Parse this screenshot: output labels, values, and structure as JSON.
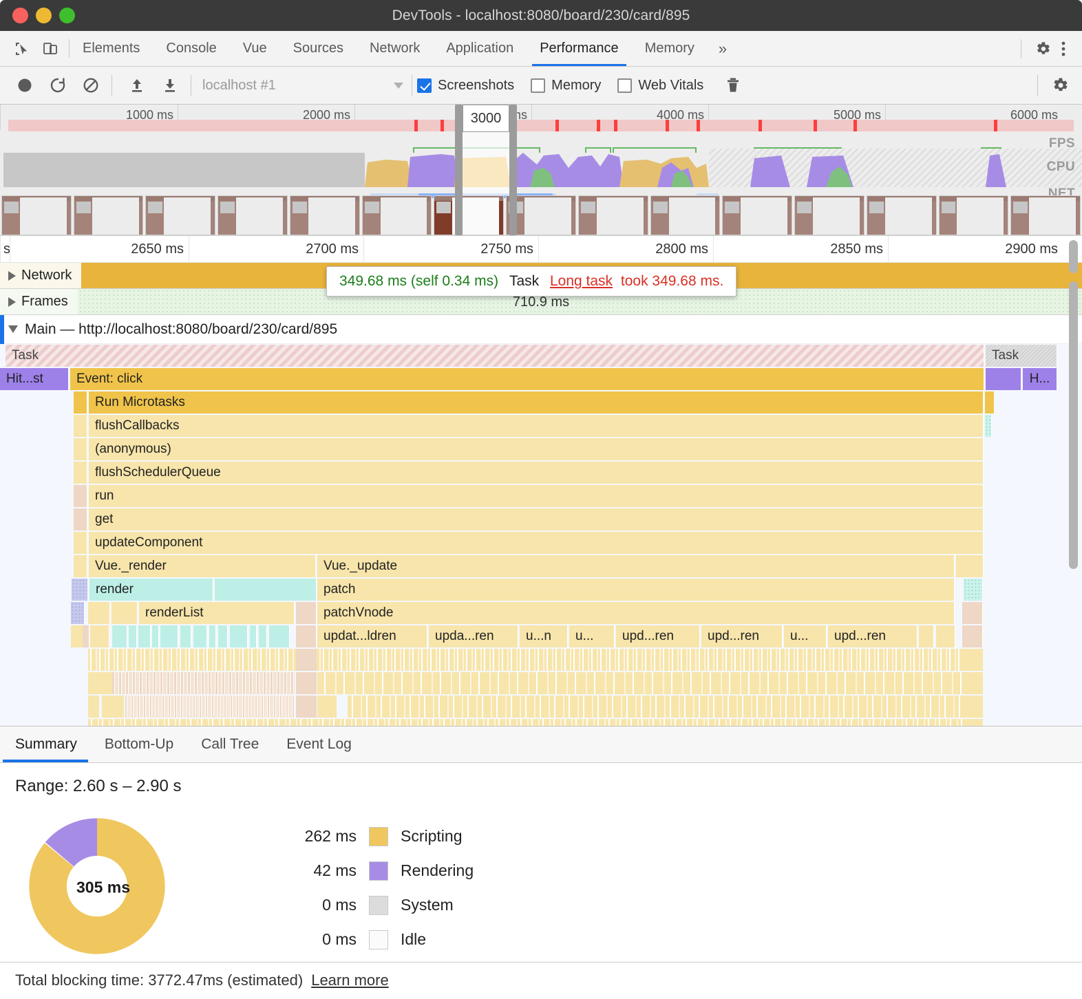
{
  "window": {
    "title": "DevTools - localhost:8080/board/230/card/895",
    "traffic": [
      "close-button",
      "minimize-button",
      "maximize-button"
    ]
  },
  "tabbar": {
    "left_icons": [
      "inspect-element-icon",
      "device-toolbar-icon"
    ],
    "tabs": [
      {
        "label": "Elements",
        "active": false
      },
      {
        "label": "Console",
        "active": false
      },
      {
        "label": "Vue",
        "active": false
      },
      {
        "label": "Sources",
        "active": false
      },
      {
        "label": "Network",
        "active": false
      },
      {
        "label": "Application",
        "active": false
      },
      {
        "label": "Performance",
        "active": true
      },
      {
        "label": "Memory",
        "active": false
      }
    ],
    "more_label": "»",
    "right_icons": [
      "settings-gear-icon",
      "more-vertical-icon"
    ]
  },
  "controlbar": {
    "record_icon": "record-circle-icon",
    "reload_icon": "reload-record-icon",
    "clear_icon": "clear-icon",
    "upload_icon": "load-profile-icon",
    "download_icon": "save-profile-icon",
    "session_value": "localhost #1",
    "checkboxes": [
      {
        "label": "Screenshots",
        "checked": true
      },
      {
        "label": "Memory",
        "checked": false
      },
      {
        "label": "Web Vitals",
        "checked": false
      }
    ],
    "trash_icon": "delete-icon",
    "settings_icon": "capture-settings-gear-icon"
  },
  "overview": {
    "ruler_ticks": [
      "1000 ms",
      "2000 ms",
      "3000 ms",
      "4000 ms",
      "5000 ms",
      "6000 ms"
    ],
    "lanes": [
      "FPS",
      "CPU",
      "NET"
    ],
    "selection_label": "3000",
    "selection_suffix": "ms"
  },
  "flamechart": {
    "ruler_ticks": [
      "s",
      "2650 ms",
      "2700 ms",
      "2750 ms",
      "2800 ms",
      "2850 ms",
      "2900 ms"
    ],
    "network_track": "Network",
    "frames_track": "Frames",
    "frames_duration": "710.9 ms",
    "main_track": "Main — http://localhost:8080/board/230/card/895",
    "task_label": "Task",
    "task_label_right": "Task",
    "rows": [
      {
        "name": "hit-test",
        "label": "Hit...st"
      },
      {
        "name": "event-click",
        "label": "Event: click"
      },
      {
        "name": "run-microtasks",
        "label": "Run Microtasks"
      },
      {
        "name": "flush-callbacks",
        "label": "flushCallbacks"
      },
      {
        "name": "anonymous",
        "label": "(anonymous)"
      },
      {
        "name": "flush-scheduler-queue",
        "label": "flushSchedulerQueue"
      },
      {
        "name": "run",
        "label": "run"
      },
      {
        "name": "get",
        "label": "get"
      },
      {
        "name": "update-component",
        "label": "updateComponent"
      },
      {
        "name": "vue-render",
        "label": "Vue._render"
      },
      {
        "name": "vue-update",
        "label": "Vue._update"
      },
      {
        "name": "render",
        "label": "render"
      },
      {
        "name": "patch",
        "label": "patch"
      },
      {
        "name": "render-list",
        "label": "renderList"
      },
      {
        "name": "patch-vnode",
        "label": "patchVnode"
      }
    ],
    "update_children_labels": [
      "updat...ldren",
      "upda...ren",
      "u...n",
      "u...",
      "upd...ren",
      "upd...ren",
      "u...",
      "upd...ren"
    ],
    "right_purple_label": "H...",
    "tooltip": {
      "duration": "349.68 ms (self 0.34 ms)",
      "name": "Task",
      "link": "Long task",
      "suffix": "took 349.68 ms."
    }
  },
  "bottom": {
    "tabs": [
      {
        "label": "Summary",
        "active": true
      },
      {
        "label": "Bottom-Up",
        "active": false
      },
      {
        "label": "Call Tree",
        "active": false
      },
      {
        "label": "Event Log",
        "active": false
      }
    ],
    "range": "Range: 2.60 s – 2.90 s",
    "donut_center": "305 ms",
    "footer_text": "Total blocking time: 3772.47ms (estimated)",
    "footer_link": "Learn more"
  },
  "chart_data": {
    "type": "pie",
    "title": "Range: 2.60 s – 2.90 s",
    "total": "305 ms",
    "legend_position": "right",
    "categories": [
      "Scripting",
      "Rendering",
      "System",
      "Idle"
    ],
    "values": [
      262,
      42,
      0,
      0
    ],
    "value_labels": [
      "262 ms",
      "42 ms",
      "0 ms",
      "0 ms"
    ],
    "colors": [
      "#efc75e",
      "#9d80e8",
      "#dcdcdc",
      "#fbfbfb"
    ]
  },
  "colors": {
    "accent": "#1a73e8",
    "scripting": "#efc75e",
    "rendering": "#9d80e8",
    "system": "#dcdcdc",
    "idle": "#fbfbfb",
    "warning_red": "#d93025",
    "duration_green": "#1b7e1b"
  }
}
